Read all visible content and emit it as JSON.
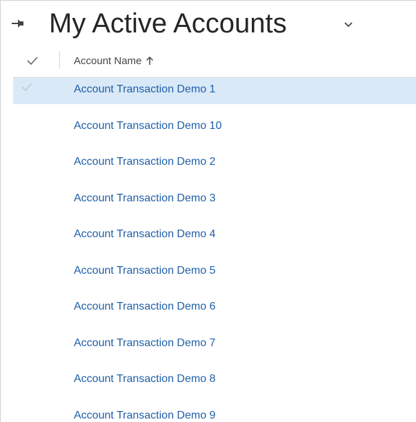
{
  "view": {
    "title": "My Active Accounts"
  },
  "grid": {
    "column_header": "Account Name",
    "sort_direction": "ascending",
    "rows": [
      {
        "name": "Account Transaction Demo 1",
        "selected": true
      },
      {
        "name": "Account Transaction Demo 10",
        "selected": false
      },
      {
        "name": "Account Transaction Demo 2",
        "selected": false
      },
      {
        "name": "Account Transaction Demo 3",
        "selected": false
      },
      {
        "name": "Account Transaction Demo 4",
        "selected": false
      },
      {
        "name": "Account Transaction Demo 5",
        "selected": false
      },
      {
        "name": "Account Transaction Demo 6",
        "selected": false
      },
      {
        "name": "Account Transaction Demo 7",
        "selected": false
      },
      {
        "name": "Account Transaction Demo 8",
        "selected": false
      },
      {
        "name": "Account Transaction Demo 9",
        "selected": false
      }
    ]
  },
  "colors": {
    "link": "#1f5fa8",
    "selected_row": "#d9e9f7",
    "title": "#262626"
  },
  "icons": {
    "pin": "pin-icon",
    "view_selector": "chevron-down-icon",
    "select_all": "checkmark-icon",
    "sort": "arrow-up-icon"
  }
}
